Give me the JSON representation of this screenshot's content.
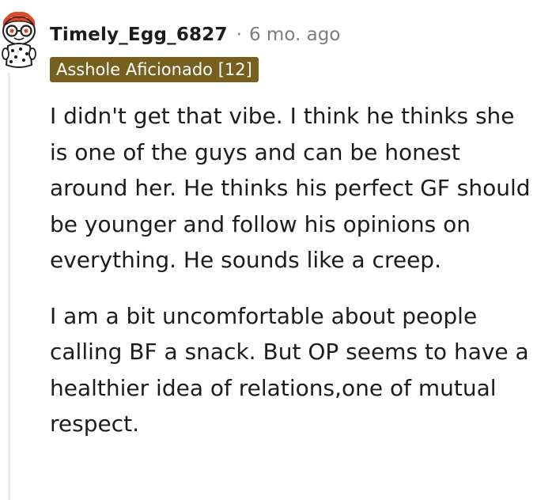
{
  "comment": {
    "author": "Timely_Egg_6827",
    "separator": "·",
    "timestamp": "6 mo. ago",
    "flair": "Asshole Aficionado [12]",
    "paragraphs": [
      "I didn't get that vibe. I think he thinks she is one of the guys and can be honest around her. He thinks his perfect GF should be younger and follow his opinions on everything. He sounds like a creep.",
      "I am a bit uncomfortable about people calling BF a snack. But OP seems to have a healthier idea of relations,one of mutual respect."
    ]
  },
  "icons": {
    "avatar": "reddit-snoo-avatar-icon"
  },
  "colors": {
    "flair_background": "#77601f",
    "flair_text": "#ffffff",
    "muted_text": "#7c7c7c",
    "body_text": "#1c1c1c",
    "thread_line": "#e9ebed"
  }
}
